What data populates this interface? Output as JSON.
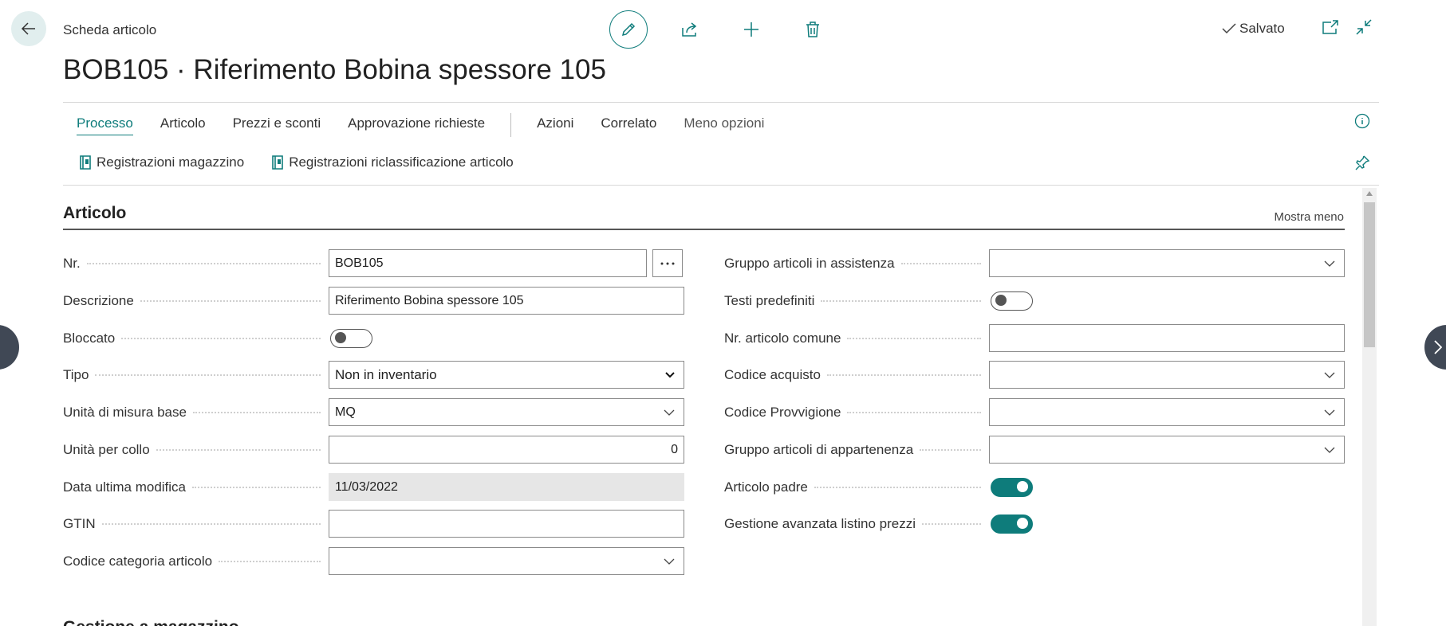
{
  "header": {
    "caption": "Scheda articolo",
    "title": "BOB105 · Riferimento Bobina spessore 105",
    "saved_label": "Salvato"
  },
  "top_actions": [
    "pencil-icon",
    "share-icon",
    "plus-icon",
    "trash-icon"
  ],
  "tabs": [
    {
      "label": "Processo",
      "active": true
    },
    {
      "label": "Articolo"
    },
    {
      "label": "Prezzi e sconti"
    },
    {
      "label": "Approvazione richieste"
    },
    {
      "label": "Azioni"
    },
    {
      "label": "Correlato"
    },
    {
      "label": "Meno opzioni"
    }
  ],
  "subactions": [
    {
      "label": "Registrazioni magazzino",
      "icon": "journal-icon"
    },
    {
      "label": "Registrazioni riclassificazione articolo",
      "icon": "journal-icon"
    }
  ],
  "section": {
    "title": "Articolo",
    "show_less": "Mostra meno",
    "next_title": "Gestione a magazzino"
  },
  "left_fields": {
    "nr": {
      "label": "Nr.",
      "value": "BOB105"
    },
    "descrizione": {
      "label": "Descrizione",
      "value": "Riferimento Bobina spessore 105"
    },
    "bloccato": {
      "label": "Bloccato",
      "value": false
    },
    "tipo": {
      "label": "Tipo",
      "value": "Non in inventario"
    },
    "unita_base": {
      "label": "Unità di misura base",
      "value": "MQ"
    },
    "unita_collo": {
      "label": "Unità per collo",
      "value": "0"
    },
    "data_modifica": {
      "label": "Data ultima modifica",
      "value": "11/03/2022"
    },
    "gtin": {
      "label": "GTIN",
      "value": ""
    },
    "codice_categoria": {
      "label": "Codice categoria articolo",
      "value": ""
    }
  },
  "right_fields": {
    "gruppo_assistenza": {
      "label": "Gruppo articoli in assistenza",
      "value": ""
    },
    "testi_predefiniti": {
      "label": "Testi predefiniti",
      "value": false
    },
    "nr_comune": {
      "label": "Nr. articolo comune",
      "value": ""
    },
    "codice_acquisto": {
      "label": "Codice acquisto",
      "value": ""
    },
    "codice_provvigione": {
      "label": "Codice Provvigione",
      "value": ""
    },
    "gruppo_appartenenza": {
      "label": "Gruppo articoli di appartenenza",
      "value": ""
    },
    "articolo_padre": {
      "label": "Articolo padre",
      "value": true
    },
    "gestione_listino": {
      "label": "Gestione avanzata listino prezzi",
      "value": true
    }
  },
  "colors": {
    "accent": "#0e7c7b",
    "text": "#212121",
    "readonly_bg": "#e6e6e6"
  }
}
